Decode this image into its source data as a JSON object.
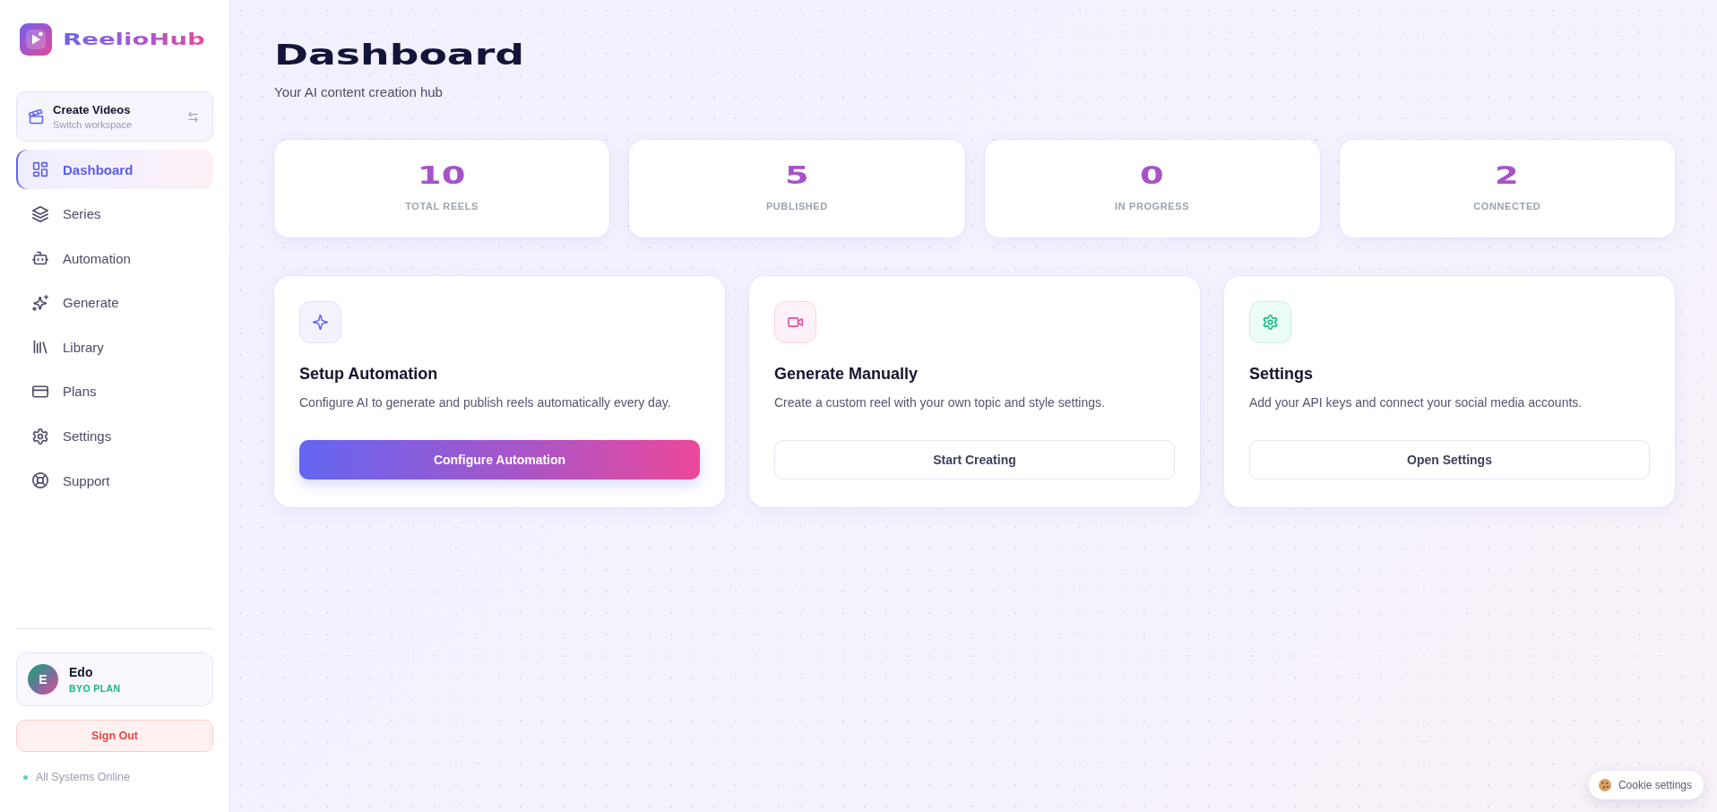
{
  "sidebar": {
    "brand": {
      "name": "ReelioHub"
    },
    "workspace": {
      "title": "Create Videos",
      "subtitle": "Switch workspace"
    },
    "nav": [
      {
        "label": "Dashboard",
        "selected": true
      },
      {
        "label": "Series",
        "selected": false
      },
      {
        "label": "Automation",
        "selected": false
      },
      {
        "label": "Generate",
        "selected": false
      },
      {
        "label": "Library",
        "selected": false
      },
      {
        "label": "Plans",
        "selected": false
      },
      {
        "label": "Settings",
        "selected": false
      },
      {
        "label": "Support",
        "selected": false
      }
    ],
    "user": {
      "initial": "E",
      "name": "Edo",
      "plan": "BYO PLAN"
    },
    "sign_out": {
      "label": "Sign Out"
    },
    "status": {
      "text": "All Systems Online"
    }
  },
  "header": {
    "title": "Dashboard",
    "subtitle": "Your AI content creation hub"
  },
  "stats": [
    {
      "value": "10",
      "label": "TOTAL REELS"
    },
    {
      "value": "5",
      "label": "PUBLISHED"
    },
    {
      "value": "0",
      "label": "IN PROGRESS"
    },
    {
      "value": "2",
      "label": "CONNECTED"
    }
  ],
  "actions": [
    {
      "title": "Setup Automation",
      "description": "Configure AI to generate and publish reels automatically every day.",
      "button": {
        "label": "Configure Automation",
        "kind": "primary"
      }
    },
    {
      "title": "Generate Manually",
      "description": "Create a custom reel with your own topic and style settings.",
      "button": {
        "label": "Start Creating",
        "kind": "outline"
      }
    },
    {
      "title": "Settings",
      "description": "Add your API keys and connect your social media accounts.",
      "button": {
        "label": "Open Settings",
        "kind": "outline"
      }
    }
  ],
  "cookie_banner": {
    "label": "Cookie settings"
  }
}
